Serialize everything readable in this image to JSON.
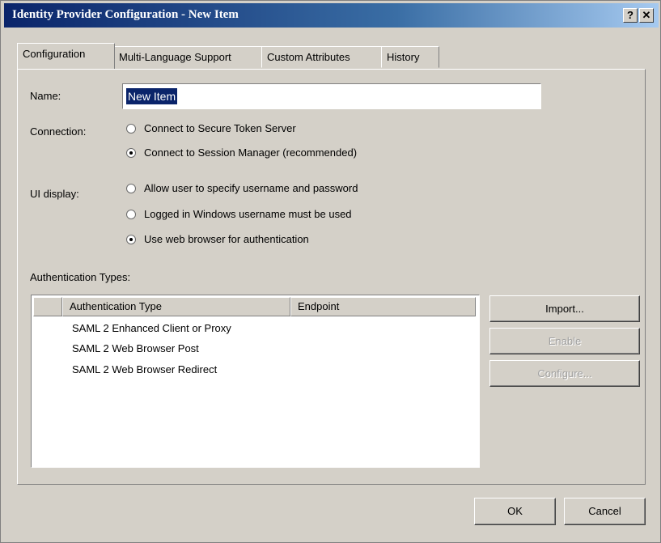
{
  "window": {
    "title": "Identity Provider Configuration - New Item",
    "help_label": "?",
    "close_label": "✕"
  },
  "tabs": [
    {
      "label": "Configuration",
      "active": true
    },
    {
      "label": "Multi-Language Support",
      "active": false
    },
    {
      "label": "Custom Attributes",
      "active": false
    },
    {
      "label": "History",
      "active": false
    }
  ],
  "name": {
    "label": "Name:",
    "value": "New Item"
  },
  "connection": {
    "label": "Connection:",
    "options": [
      {
        "label": "Connect to Secure Token Server",
        "selected": false
      },
      {
        "label": "Connect to Session Manager (recommended)",
        "selected": true
      }
    ]
  },
  "ui_display": {
    "label": "UI display:",
    "options": [
      {
        "label": "Allow user to specify username and password",
        "selected": false
      },
      {
        "label": "Logged in Windows username must be used",
        "selected": false
      },
      {
        "label": "Use web browser for authentication",
        "selected": true
      }
    ]
  },
  "auth_types": {
    "label": "Authentication Types:",
    "columns": [
      "",
      "Authentication Type",
      "Endpoint"
    ],
    "rows": [
      {
        "type": "SAML 2 Enhanced Client or Proxy",
        "endpoint": ""
      },
      {
        "type": "SAML 2 Web Browser Post",
        "endpoint": ""
      },
      {
        "type": "SAML 2 Web Browser Redirect",
        "endpoint": ""
      }
    ]
  },
  "side_buttons": {
    "import": "Import...",
    "enable": "Enable",
    "configure": "Configure..."
  },
  "footer": {
    "ok": "OK",
    "cancel": "Cancel"
  }
}
